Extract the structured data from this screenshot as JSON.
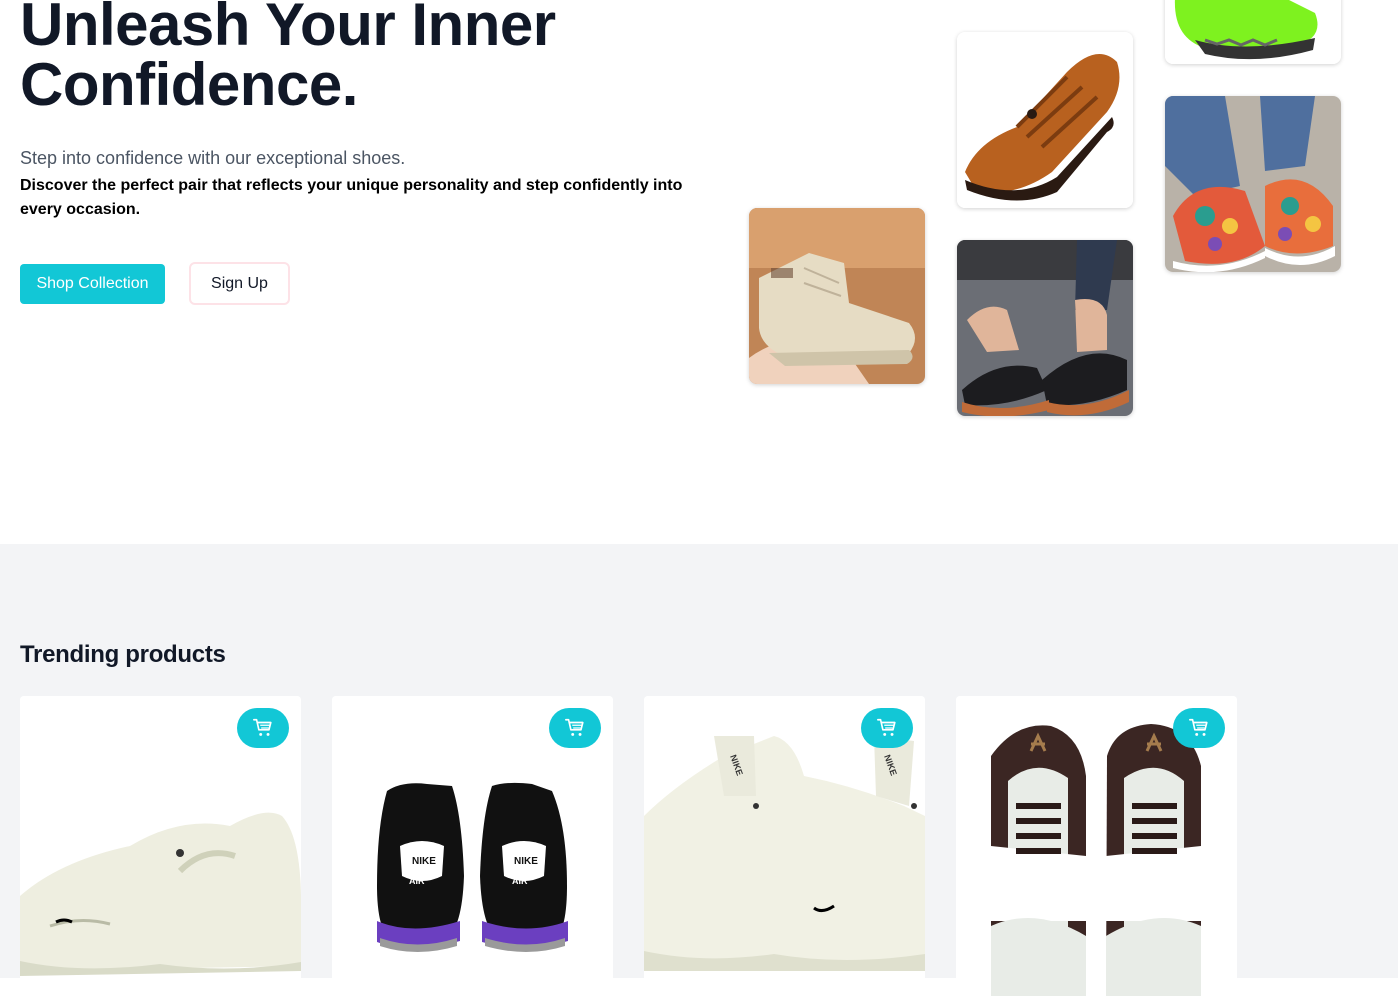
{
  "hero": {
    "title": "Unleash Your Inner Confidence.",
    "subtitle": "Step into confidence with our exceptional shoes.",
    "description": "Discover the perfect pair that reflects your unique personality and step confidently into every occasion.",
    "shop_label": "Shop Collection",
    "signup_label": "Sign Up"
  },
  "gallery": [
    {
      "name": "beige-high-top-sneaker"
    },
    {
      "name": "brown-leather-sandal"
    },
    {
      "name": "black-wedge-sandal"
    },
    {
      "name": "green-sneaker"
    },
    {
      "name": "colorful-paisley-slip-on"
    }
  ],
  "trending": {
    "title": "Trending products",
    "products": [
      {
        "name": "white-chunky-sneaker"
      },
      {
        "name": "black-air-basketball-shoe"
      },
      {
        "name": "cream-chunky-sneaker"
      },
      {
        "name": "brown-white-jordan-low"
      }
    ],
    "cart_icon": "cart-icon"
  },
  "colors": {
    "accent": "#12c7d6",
    "title": "#111827",
    "section_bg": "#f3f4f6",
    "signup_border": "#fde2e7"
  }
}
